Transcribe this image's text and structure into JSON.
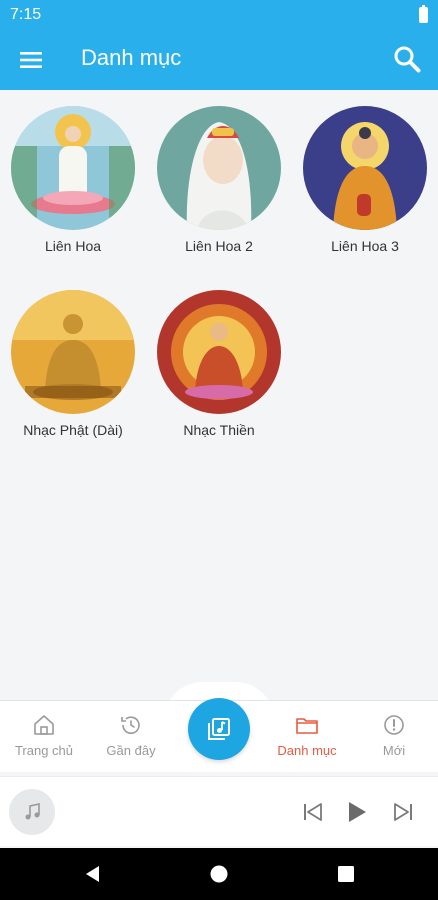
{
  "status_bar": {
    "time": "7:15"
  },
  "app_bar": {
    "title": "Danh mục"
  },
  "categories": [
    {
      "label": "Liên Hoa"
    },
    {
      "label": "Liên Hoa 2"
    },
    {
      "label": "Liên Hoa 3"
    },
    {
      "label": "Nhạc Phật (Dài)"
    },
    {
      "label": "Nhạc Thiền"
    }
  ],
  "bottom_nav": {
    "items": [
      {
        "label": "Trang chủ",
        "icon": "home-icon"
      },
      {
        "label": "Gần đây",
        "icon": "history-icon"
      },
      {
        "label": "Danh mục",
        "icon": "folder-icon",
        "active": true
      },
      {
        "label": "Mới",
        "icon": "alert-circle-icon"
      }
    ],
    "center_icon": "music-library-icon"
  },
  "player": {
    "art_icon": "music-note-icon"
  },
  "colors": {
    "primary": "#29b0ec",
    "fab": "#1ea6e3",
    "active": "#e85a41",
    "inactive": "#999999"
  }
}
